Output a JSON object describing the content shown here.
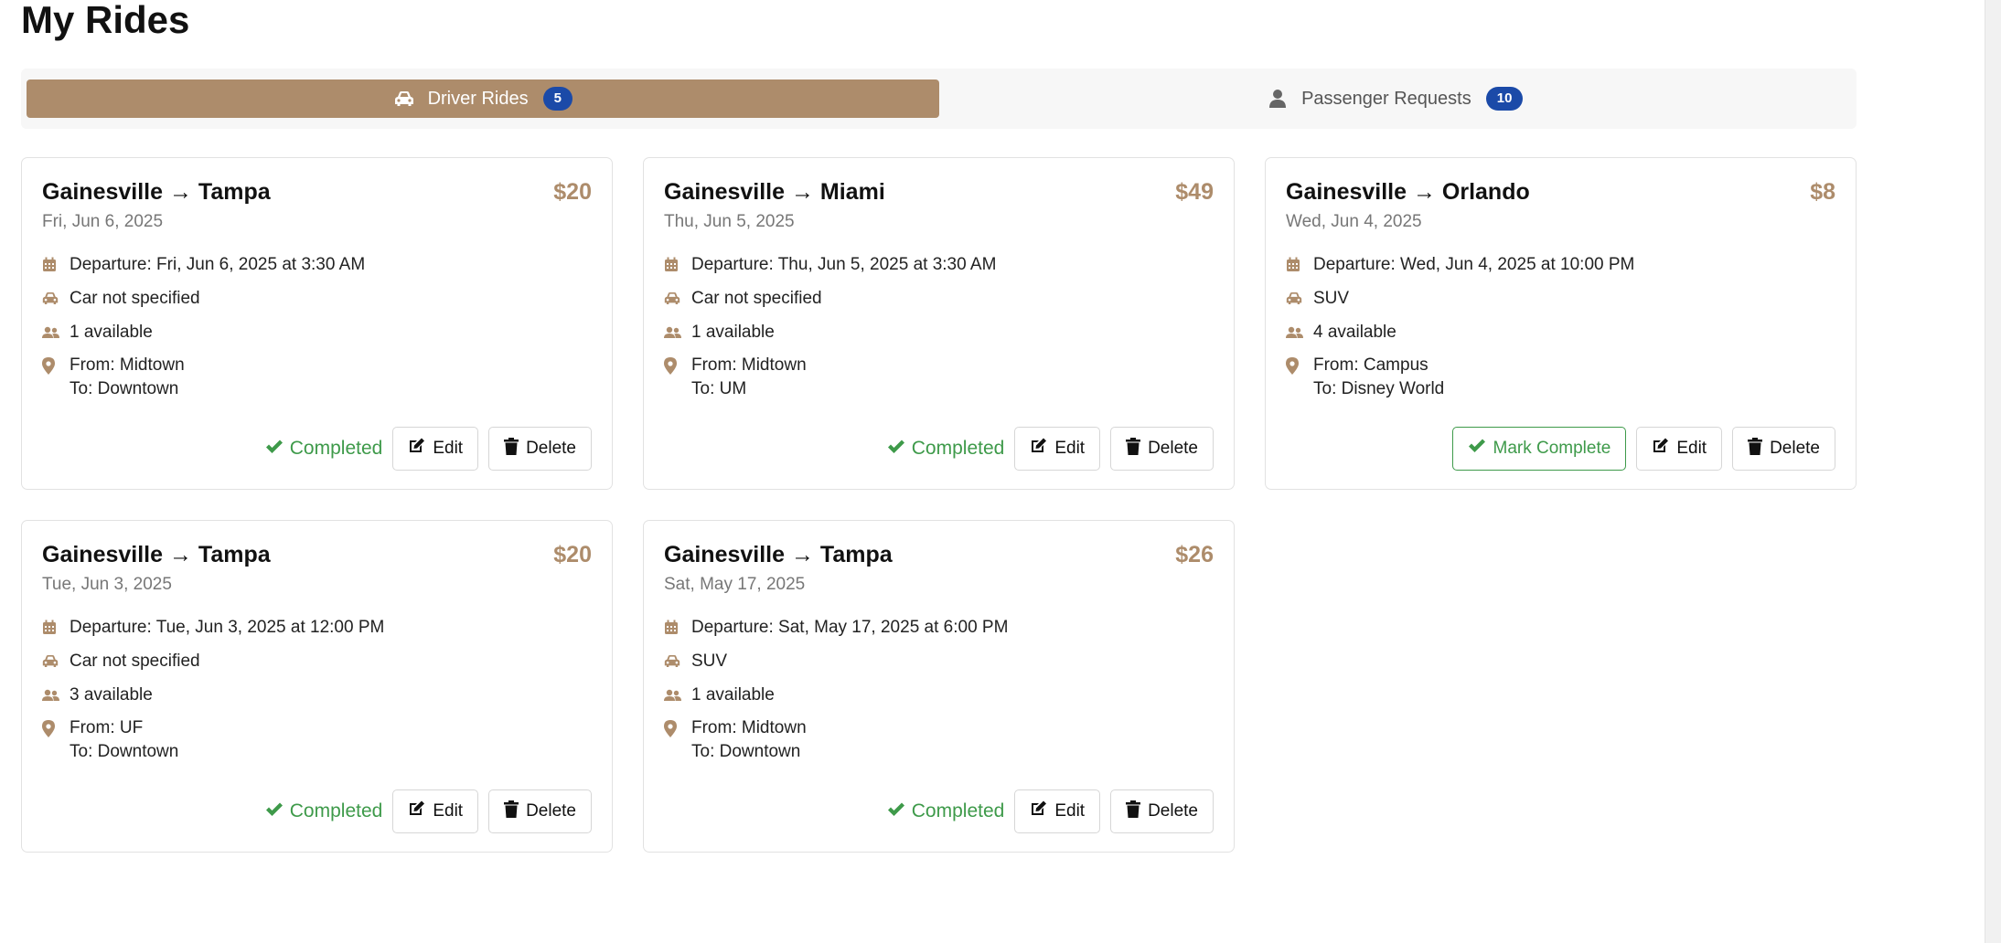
{
  "page": {
    "title": "My Rides"
  },
  "tabs": [
    {
      "label": "Driver Rides",
      "count": "5",
      "icon": "car-icon"
    },
    {
      "label": "Passenger Requests",
      "count": "10",
      "icon": "user-icon"
    }
  ],
  "colors": {
    "accent": "#ad8c6b",
    "badge": "#1b4aa8",
    "success": "#3e9a4a"
  },
  "rides": [
    {
      "route": "Gainesville → Tampa",
      "price": "$20",
      "date": "Fri, Jun 6, 2025",
      "departure": "Departure: Fri, Jun 6, 2025 at 3:30 AM",
      "car": "Car not specified",
      "seats": "1 available",
      "from": "From: Midtown",
      "to": "To: Downtown",
      "status": "Completed",
      "edit": "Edit",
      "delete": "Delete"
    },
    {
      "route": "Gainesville → Miami",
      "price": "$49",
      "date": "Thu, Jun 5, 2025",
      "departure": "Departure: Thu, Jun 5, 2025 at 3:30 AM",
      "car": "Car not specified",
      "seats": "1 available",
      "from": "From: Midtown",
      "to": "To: UM",
      "status": "Completed",
      "edit": "Edit",
      "delete": "Delete"
    },
    {
      "route": "Gainesville → Orlando",
      "price": "$8",
      "date": "Wed, Jun 4, 2025",
      "departure": "Departure: Wed, Jun 4, 2025 at 10:00 PM",
      "car": "SUV",
      "seats": "4 available",
      "from": "From: Campus",
      "to": "To: Disney World",
      "status": "Mark Complete",
      "edit": "Edit",
      "delete": "Delete"
    },
    {
      "route": "Gainesville → Tampa",
      "price": "$20",
      "date": "Tue, Jun 3, 2025",
      "departure": "Departure: Tue, Jun 3, 2025 at 12:00 PM",
      "car": "Car not specified",
      "seats": "3 available",
      "from": "From: UF",
      "to": "To: Downtown",
      "status": "Completed",
      "edit": "Edit",
      "delete": "Delete"
    },
    {
      "route": "Gainesville → Tampa",
      "price": "$26",
      "date": "Sat, May 17, 2025",
      "departure": "Departure: Sat, May 17, 2025 at 6:00 PM",
      "car": "SUV",
      "seats": "1 available",
      "from": "From: Midtown",
      "to": "To: Downtown",
      "status": "Completed",
      "edit": "Edit",
      "delete": "Delete"
    }
  ]
}
